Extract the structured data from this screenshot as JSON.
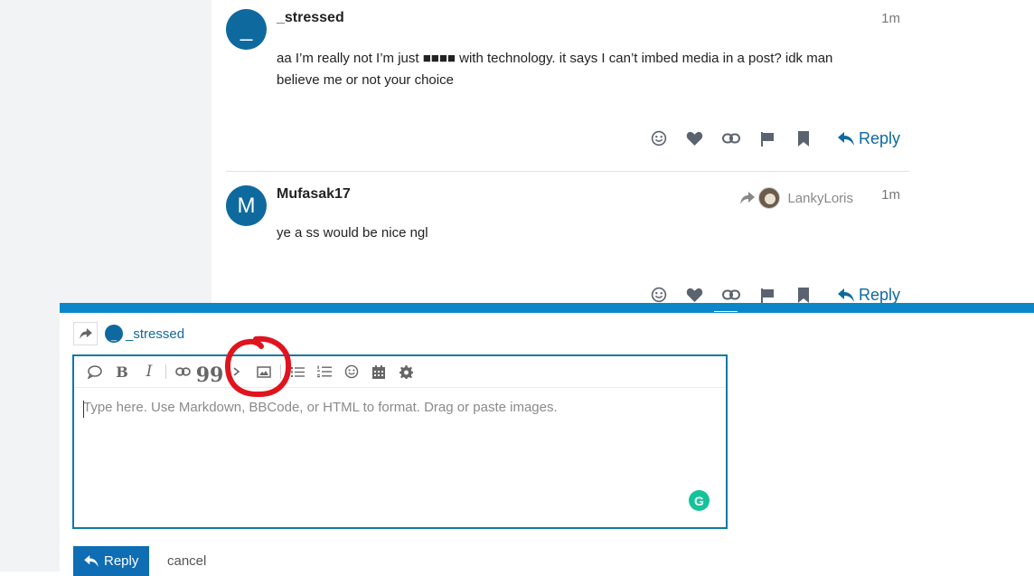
{
  "posts": [
    {
      "avatar_letter": "_",
      "username": "_stressed",
      "date": "1m",
      "body_lines": [
        "aa I’m really not I’m just ■■■■ with technology. it says I can’t imbed media in a post? idk man",
        "believe me or not your choice"
      ],
      "reply_label": "Reply"
    },
    {
      "avatar_letter": "M",
      "username": "Mufasak17",
      "date": "1m",
      "reply_to_user": "LankyLoris",
      "body_lines": [
        "ye a ss would be nice ngl"
      ],
      "reply_label": "Reply"
    }
  ],
  "post_action_icons": [
    "smile-icon",
    "heart-icon",
    "link-icon",
    "flag-icon",
    "bookmark-icon",
    "reply-icon"
  ],
  "composer": {
    "reply_to_avatar_letter": "_",
    "reply_to_user": "_stressed",
    "placeholder": "Type here. Use Markdown, BBCode, or HTML to format. Drag or paste images.",
    "toolbar": [
      "quote-bubble-icon",
      "bold-icon",
      "italic-icon",
      "link-icon",
      "blockquote-icon",
      "code-icon",
      "image-upload-icon",
      "bullet-list-icon",
      "numbered-list-icon",
      "emoji-icon",
      "calendar-icon",
      "gear-icon"
    ],
    "toolbar_glyphs": {
      "bold": "B",
      "italic": "I",
      "quote": "99"
    },
    "grammarly_letter": "G",
    "submit_label": "Reply",
    "cancel_label": "cancel"
  },
  "colors": {
    "accent": "#0e6a9e",
    "composer_bar": "#0b87c9",
    "annotation": "#e0141e",
    "grammarly": "#15c39a"
  }
}
